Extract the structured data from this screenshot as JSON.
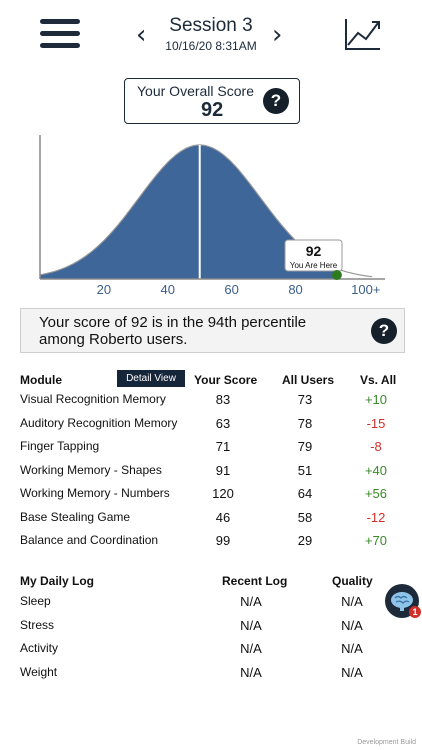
{
  "header": {
    "session_title": "Session 3",
    "session_date": "10/16/20 8:31AM",
    "prev_icon": "chevron-left-icon",
    "next_icon": "chevron-right-icon",
    "menu_icon": "hamburger-menu-icon",
    "trend_icon": "trend-chart-icon"
  },
  "overall": {
    "label": "Your Overall Score",
    "value": "92",
    "help": "?"
  },
  "chart_data": {
    "type": "area",
    "x_ticks": [
      "20",
      "40",
      "60",
      "80",
      "100+"
    ],
    "xlim": [
      0,
      108
    ],
    "mean_line_x": 50,
    "marker": {
      "x": 92,
      "value_label": "92",
      "caption": "You Are Here"
    },
    "fill_color": "#3e6699",
    "marker_color": "#2d7a1f"
  },
  "percentile": {
    "text": "Your score of 92 is in the 94th percentile among Roberto users.",
    "help": "?"
  },
  "modules": {
    "headers": {
      "module": "Module",
      "detail": "Detail View",
      "your": "Your Score",
      "all": "All Users",
      "vs": "Vs. All"
    },
    "rows": [
      {
        "name": "Visual Recognition Memory",
        "your": "83",
        "all": "73",
        "vs": "+10",
        "sign": "pos"
      },
      {
        "name": "Auditory Recognition Memory",
        "your": "63",
        "all": "78",
        "vs": "-15",
        "sign": "neg"
      },
      {
        "name": "Finger Tapping",
        "your": "71",
        "all": "79",
        "vs": "-8",
        "sign": "neg"
      },
      {
        "name": "Working Memory - Shapes",
        "your": "91",
        "all": "51",
        "vs": "+40",
        "sign": "pos"
      },
      {
        "name": "Working Memory - Numbers",
        "your": "120",
        "all": "64",
        "vs": "+56",
        "sign": "pos"
      },
      {
        "name": "Base Stealing Game",
        "your": "46",
        "all": "58",
        "vs": "-12",
        "sign": "neg"
      },
      {
        "name": "Balance and Coordination",
        "your": "99",
        "all": "29",
        "vs": "+70",
        "sign": "pos"
      }
    ]
  },
  "log": {
    "headers": {
      "title": "My Daily Log",
      "recent": "Recent Log",
      "quality": "Quality"
    },
    "rows": [
      {
        "name": "Sleep",
        "recent": "N/A",
        "quality": "N/A"
      },
      {
        "name": "Stress",
        "recent": "N/A",
        "quality": "N/A"
      },
      {
        "name": "Activity",
        "recent": "N/A",
        "quality": "N/A"
      },
      {
        "name": "Weight",
        "recent": "N/A",
        "quality": "N/A"
      }
    ]
  },
  "fab": {
    "icon": "brain-icon",
    "badge": "1"
  },
  "footer": {
    "mark": "Development Build"
  }
}
